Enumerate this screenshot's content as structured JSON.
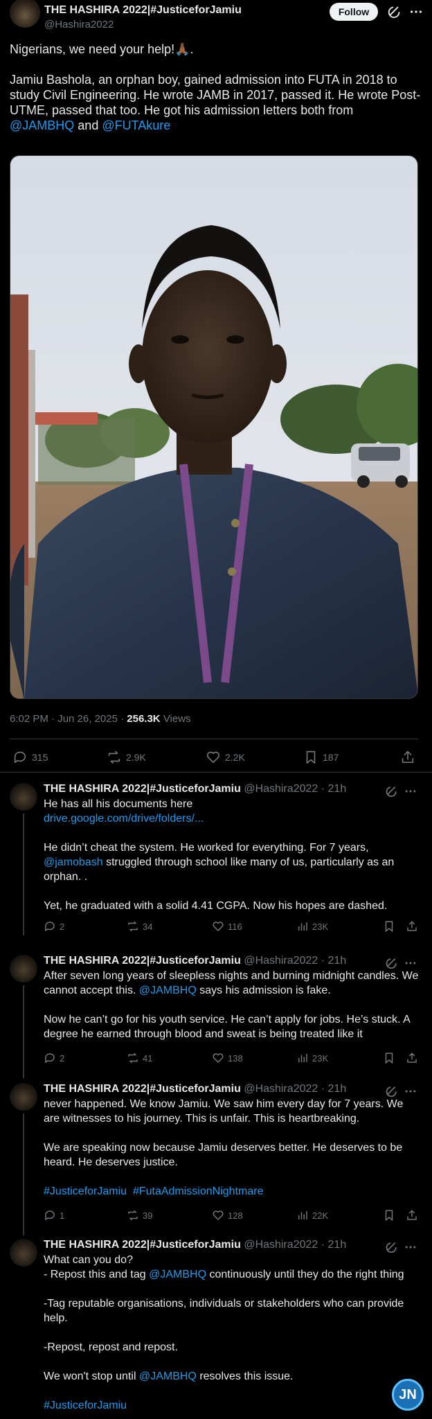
{
  "post": {
    "author_name": "THE HASHIRA 2022|#JusticeforJamiu",
    "handle": "@Hashira2022",
    "follow_label": "Follow",
    "para1": "Nigerians, we need your help!🙏🏾.",
    "para2_text": "Jamiu Bashola, an orphan boy, gained admission into FUTA in 2018 to study Civil Engineering. He wrote JAMB in 2017, passed it. He wrote Post-UTME, passed that too. He got his admission letters  both from",
    "mention1": "@JAMBHQ",
    "and_text": "and",
    "mention2": "@FUTAkure",
    "time": "6:02 PM · Jun 26, 2025 · ",
    "views_count": "256.3K",
    "views_label": "Views",
    "replies": "315",
    "reposts": "2.9K",
    "likes": "2.2K",
    "bookmarks": "187"
  },
  "replies": [
    {
      "name": "THE HASHIRA 2022|#JusticeforJamiu",
      "meta": "@Hashira2022 · 21h",
      "line1": "He has all his documents here",
      "link": "drive.google.com/drive/folders/...",
      "p2_a": "He didn’t cheat the system. He worked for everything. For 7 years,",
      "p2_mention": "@jamobash",
      "p2_b": "struggled through school like many of us, particularly as an orphan. .",
      "p3": "Yet, he graduated with a solid 4.41 CGPA.  Now his hopes are dashed.",
      "replies": "2",
      "reposts": "34",
      "likes": "116",
      "views": "23K"
    },
    {
      "name": "THE HASHIRA 2022|#JusticeforJamiu",
      "meta": "@Hashira2022 · 21h",
      "p1_a": "After seven long years of sleepless nights and burning midnight candles. We cannot accept this.",
      "p1_mention": "@JAMBHQ",
      "p1_b": "says his admission is fake.",
      "p2": "Now he can’t go for his youth service. He can’t apply for jobs. He’s stuck. A degree he earned through blood and sweat is being treated like it",
      "replies": "2",
      "reposts": "41",
      "likes": "138",
      "views": "23K"
    },
    {
      "name": "THE HASHIRA 2022|#JusticeforJamiu",
      "meta": "@Hashira2022 · 21h",
      "p1": "never happened. We know Jamiu. We saw him every day for 7 years. We are witnesses to his journey. This is unfair. This is heartbreaking.",
      "p2": "We are speaking now because Jamiu deserves better. He deserves to be heard. He deserves justice.",
      "tag1": "#JusticeforJamiu",
      "tag2": "#FutaAdmissionNightmare",
      "replies": "1",
      "reposts": "39",
      "likes": "128",
      "views": "22K"
    },
    {
      "name": "THE HASHIRA 2022|#JusticeforJamiu",
      "meta": "@Hashira2022 · 21h",
      "l1": "What can you do?",
      "l2_a": "- Repost this and tag",
      "l2_mention": "@JAMBHQ",
      "l2_b": "continuously until they do the right thing",
      "p2": "-Tag reputable organisations, individuals or stakeholders who can provide help.",
      "p3": "-Repost, repost and repost.",
      "p4_a": "We won't stop until",
      "p4_mention": "@JAMBHQ",
      "p4_b": "resolves this issue.",
      "tag": "#JusticeforJamiu"
    }
  ],
  "badge": {
    "label": "JN"
  },
  "colors": {
    "background": "#000000",
    "accent": "#1d9bf0",
    "muted": "#71767b",
    "text": "#e7e9ea"
  }
}
